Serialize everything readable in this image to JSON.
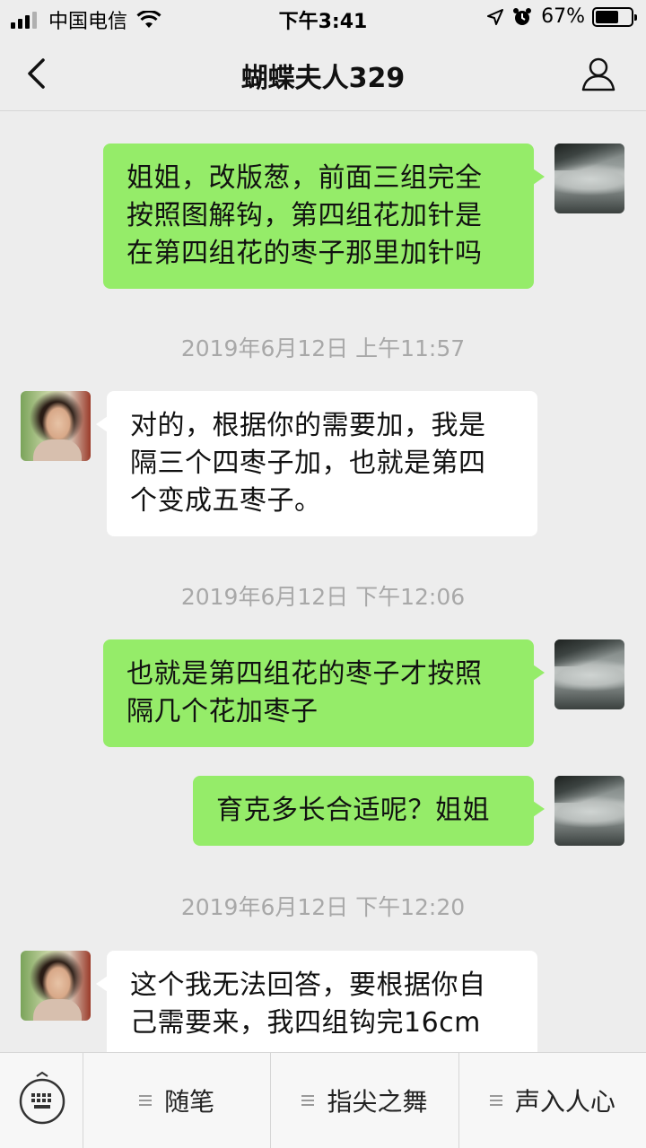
{
  "status_bar": {
    "carrier": "中国电信",
    "time": "下午3:41",
    "battery": "67%",
    "battery_level": 0.67
  },
  "nav": {
    "title": "蝴蝶夫人329"
  },
  "messages": [
    {
      "side": "out",
      "text": "姐姐，改版葱，前面三组完全\n按照图解钩，第四组花加针是\n在第四组花的枣子那里加针吗"
    },
    {
      "side": "in",
      "text": "对的，根据你的需要加，我是\n隔三个四枣子加，也就是第四\n个变成五枣子。"
    },
    {
      "side": "out",
      "text": "也就是第四组花的枣子才按照\n隔几个花加枣子"
    },
    {
      "side": "out",
      "text": "育克多长合适呢？姐姐"
    },
    {
      "side": "in",
      "text": "这个我无法回答，要根据你自\n己需要来，我四组钩完16cm"
    }
  ],
  "timestamps": [
    "2019年6月12日 上午11:57",
    "2019年6月12日 下午12:06",
    "2019年6月12日 下午12:20"
  ],
  "bottom_menu": {
    "items": [
      "随笔",
      "指尖之舞",
      "声入人心"
    ]
  }
}
